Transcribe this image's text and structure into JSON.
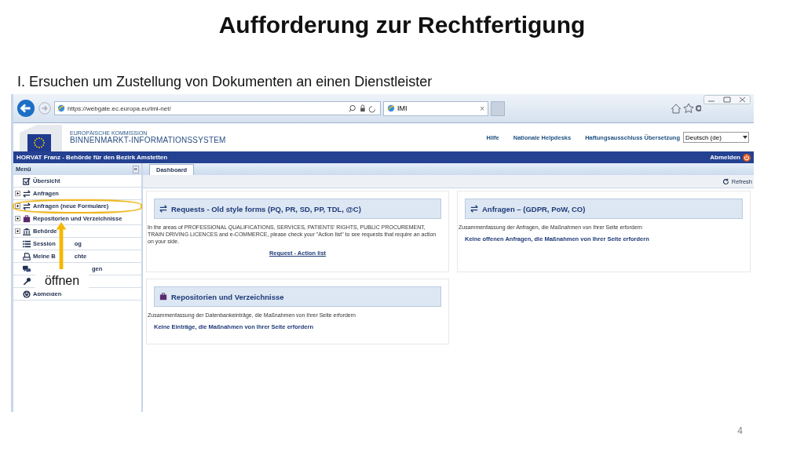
{
  "slide": {
    "title": "Aufforderung zur Rechtfertigung",
    "subtitle": "I. Ersuchen um Zustellung von Dokumenten an einen Dienstleister",
    "page_number": "4"
  },
  "browser": {
    "address": "https://webgate.ec.europa.eu/imi-net/",
    "tab": {
      "title": "IMI",
      "close": "×"
    }
  },
  "header": {
    "org": "EUROPÄISCHE KOMMISSION",
    "system": "BINNENMARKT-INFORMATIONSSYSTEM",
    "links": [
      "Hilfe",
      "Nationale Helpdesks",
      "Haftungsausschluss Übersetzung"
    ],
    "language": "Deutsch (de)"
  },
  "user_bar": {
    "user": "HORVAT Franz - Behörde für den Bezirk Amstetten",
    "logout": "Abmelden"
  },
  "menu": {
    "title": "Menü",
    "collapse": "«",
    "items": [
      {
        "kind": "leaf",
        "label": "Übersicht",
        "highlighted": false
      },
      {
        "kind": "group",
        "expanded": false,
        "label": "Anfragen",
        "highlighted": false
      },
      {
        "kind": "group",
        "expanded": false,
        "label": "Anfragen (neue Formulare)",
        "highlighted": true
      },
      {
        "kind": "group",
        "expanded": false,
        "label": "Repositorien und Verzeichnisse",
        "highlighted": false
      },
      {
        "kind": "group",
        "expanded": false,
        "label": "Behörde",
        "highlighted": false
      },
      {
        "kind": "leaf",
        "label": "Session",
        "label_after": "og",
        "highlighted": false
      },
      {
        "kind": "leaf",
        "label": "Meine B",
        "label_after": "chte",
        "highlighted": false
      },
      {
        "kind": "leaf",
        "label_after": "gen",
        "highlighted": false
      },
      {
        "kind": "leaf",
        "highlighted": false
      },
      {
        "kind": "leaf",
        "label": "Abmelden",
        "highlighted": false
      }
    ]
  },
  "annotation": {
    "label": "öffnen"
  },
  "tabs": [
    {
      "label": "Dashboard",
      "selected": true
    }
  ],
  "toolbar": {
    "refresh": "Refresh"
  },
  "panels": [
    {
      "title": "Requests - Old style forms (PQ, PR, SD, PP, TDL, @C)",
      "text": "In the areas of PROFESSIONAL QUALIFICATIONS, SERVICES, PATIENTS' RIGHTS, PUBLIC PROCUREMENT, TRAIN DRIVING LICENCES and e-COMMERCE, please check your \"Action list\" to see requests that require an action on your side.",
      "link": "Request - Action list"
    },
    {
      "title": "Anfragen – (GDPR, PoW, CO)",
      "text": "Zusammenfassung der Anfragen, die Maßnahmen von Ihrer Seite erfordern",
      "link": "Keine offenen Anfragen, die Maßnahmen von Ihrer Seite erfordern"
    },
    {
      "title": "Repositorien und Verzeichnisse",
      "text": "Zusammenfassung der Datenbankeinträge, die Maßnahmen von Ihrer Seite erfordern",
      "link": "Keine Einträge, die Maßnahmen von Ihrer Seite erfordern"
    }
  ]
}
